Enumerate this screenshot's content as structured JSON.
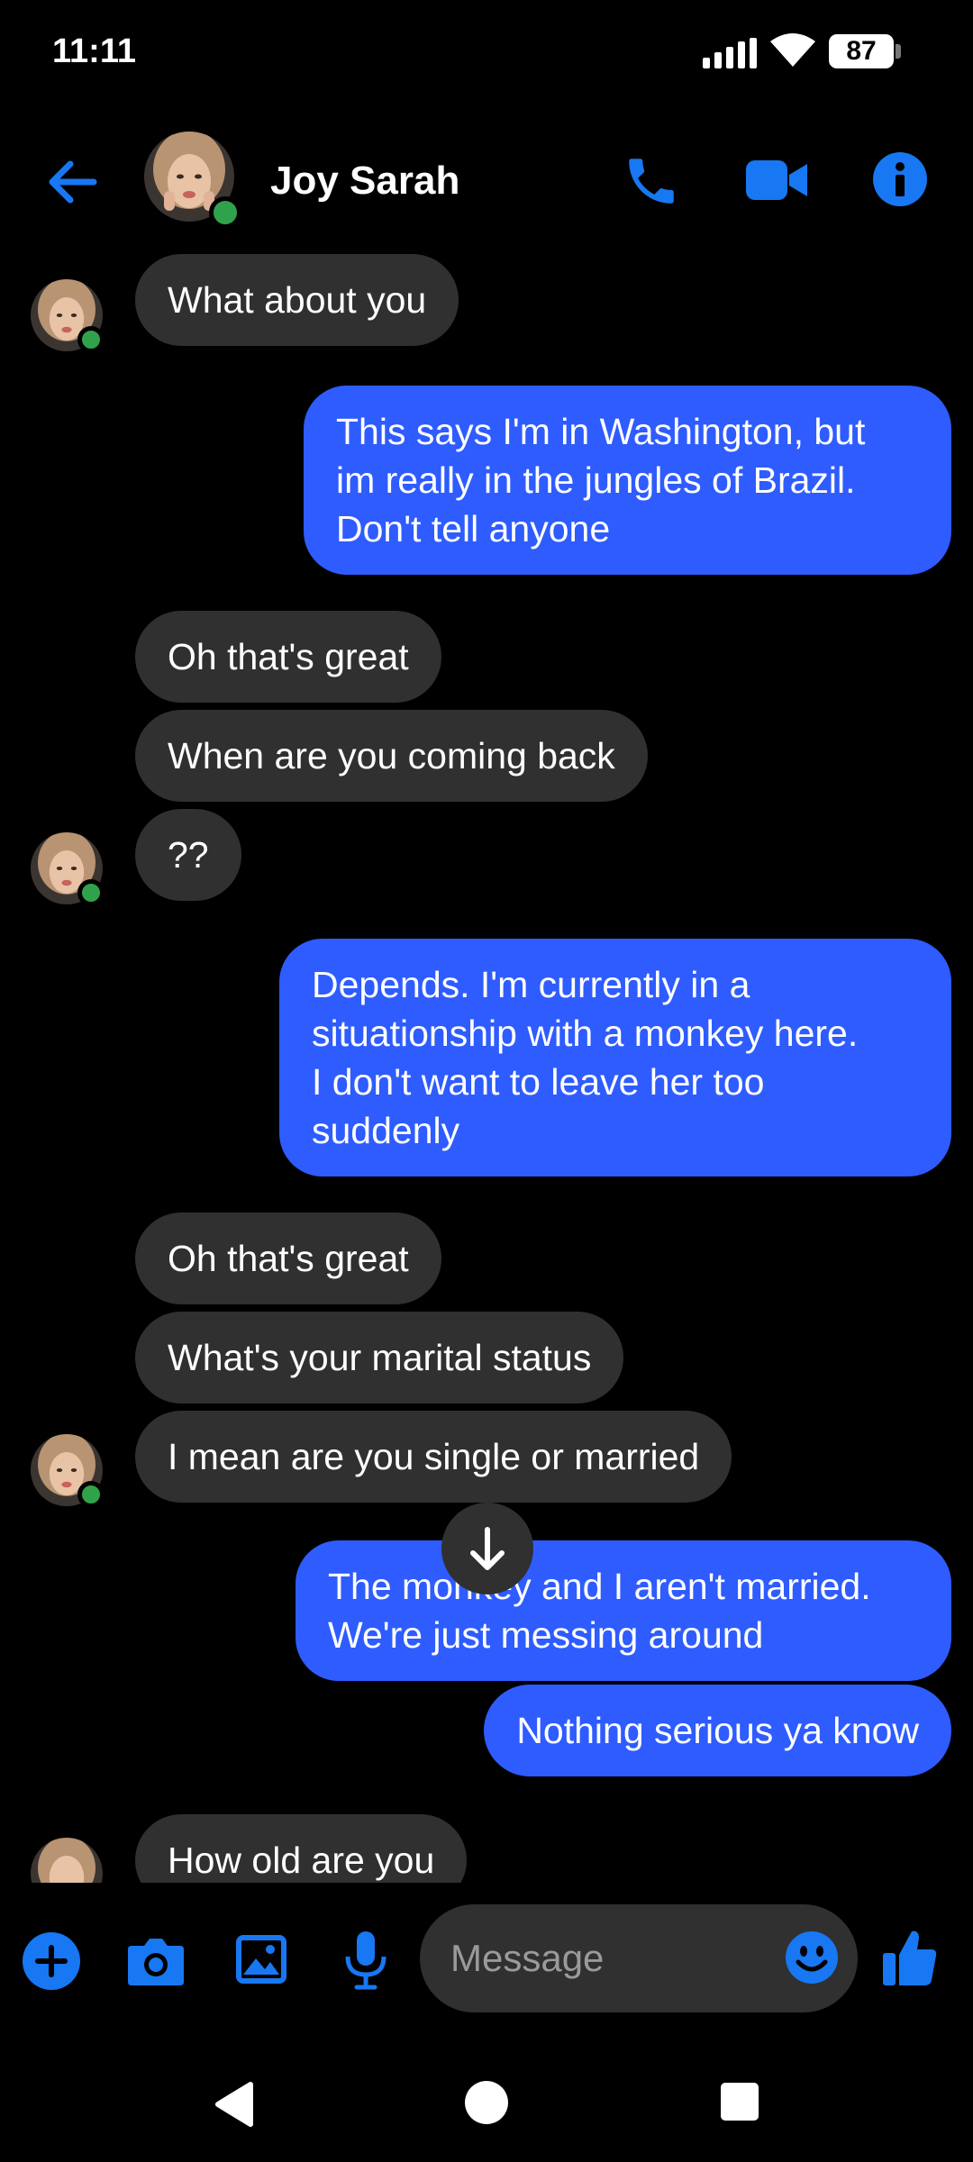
{
  "status_bar": {
    "time": "11:11",
    "battery": "87"
  },
  "header": {
    "contact_name": "Joy Sarah",
    "icons": [
      "back-arrow-icon",
      "phone-icon",
      "video-camera-icon",
      "info-icon"
    ]
  },
  "messages": [
    {
      "dir": "in",
      "text": "What about you"
    },
    {
      "dir": "out",
      "lines": [
        "This says I'm in Washington, but",
        "im really in the jungles of Brazil.",
        "Don't tell anyone"
      ]
    },
    {
      "dir": "in",
      "text": "Oh that's great"
    },
    {
      "dir": "in",
      "text": "When are you coming back"
    },
    {
      "dir": "in",
      "text": "??"
    },
    {
      "dir": "out",
      "lines": [
        "Depends. I'm currently in a",
        "situationship with a monkey here.",
        "I don't want to leave her too",
        "suddenly"
      ]
    },
    {
      "dir": "in",
      "text": "Oh that's great"
    },
    {
      "dir": "in",
      "text": "What's your marital status"
    },
    {
      "dir": "in",
      "text": "I mean are you single or married"
    },
    {
      "dir": "out",
      "lines": [
        "The monkey and I aren't married.",
        "We're just messing around"
      ]
    },
    {
      "dir": "out",
      "text": "Nothing serious ya know"
    },
    {
      "dir": "in",
      "text": "How old are you"
    }
  ],
  "composer": {
    "placeholder": "Message",
    "icons": [
      "plus-icon",
      "camera-icon",
      "gallery-icon",
      "microphone-icon",
      "emoji-icon",
      "thumbs-up-icon"
    ]
  },
  "colors": {
    "accent": "#1877f2",
    "outgoing_bubble": "#2e5cff",
    "incoming_bubble": "#303030",
    "online": "#31a24c"
  }
}
